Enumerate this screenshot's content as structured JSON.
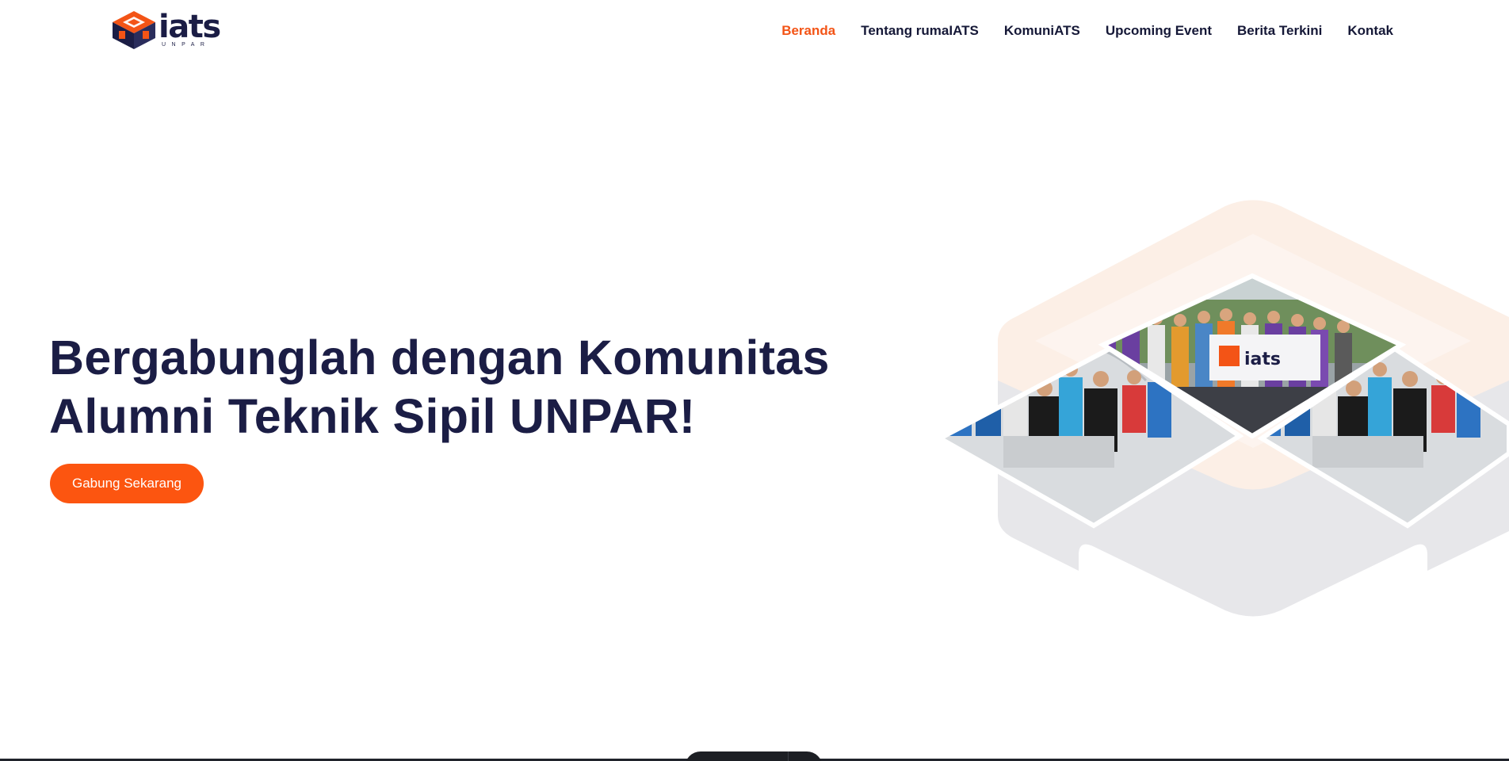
{
  "brand": {
    "word": "iats",
    "sub": "UNPAR",
    "orange": "#f35416",
    "navy": "#1b1d45"
  },
  "nav": {
    "items": [
      {
        "label": "Beranda",
        "active": true
      },
      {
        "label": "Tentang rumaIATS",
        "active": false
      },
      {
        "label": "KomuniATS",
        "active": false
      },
      {
        "label": "Upcoming Event",
        "active": false
      },
      {
        "label": "Berita Terkini",
        "active": false
      },
      {
        "label": "Kontak",
        "active": false
      }
    ]
  },
  "hero": {
    "title_line1": "Bergabunglah dengan Komunitas",
    "title_line2": "Alumni Teknik Sipil UNPAR!",
    "cta_label": "Gabung Sekarang",
    "cta_color": "#fc5510"
  },
  "collage": {
    "photos": [
      "group-photo-banner",
      "group-photo-indoor",
      "group-photo-indoor"
    ],
    "banner_text": "iats"
  }
}
